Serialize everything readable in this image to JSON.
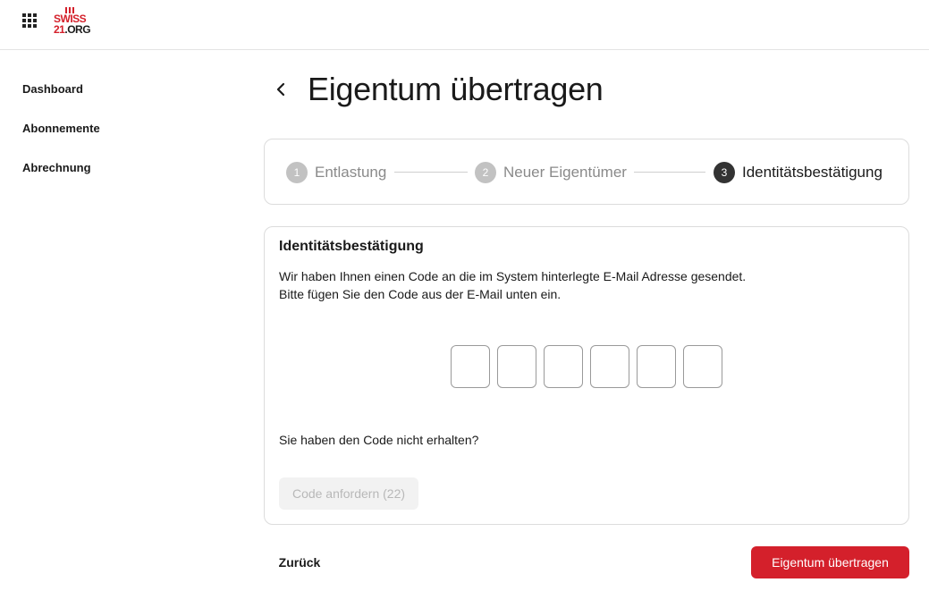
{
  "header": {
    "logo_top": "SWISS",
    "logo_bottom_a": "21",
    "logo_bottom_b": ".ORG"
  },
  "sidebar": {
    "items": [
      {
        "label": "Dashboard"
      },
      {
        "label": "Abonnemente"
      },
      {
        "label": "Abrechnung"
      }
    ]
  },
  "page": {
    "title": "Eigentum übertragen"
  },
  "stepper": {
    "steps": [
      {
        "number": "1",
        "label": "Entlastung",
        "state": "inactive"
      },
      {
        "number": "2",
        "label": "Neuer Eigentümer",
        "state": "inactive"
      },
      {
        "number": "3",
        "label": "Identitätsbestätigung",
        "state": "active"
      }
    ]
  },
  "verification": {
    "title": "Identitätsbestätigung",
    "description_line1": "Wir haben Ihnen einen Code an die im System hinterlegte E-Mail Adresse gesendet.",
    "description_line2": "Bitte fügen Sie den Code aus der E-Mail unten ein.",
    "code_digits": [
      "",
      "",
      "",
      "",
      "",
      ""
    ],
    "not_received": "Sie haben den Code nicht erhalten?",
    "resend_label": "Code anfordern (22)"
  },
  "actions": {
    "back_label": "Zurück",
    "submit_label": "Eigentum übertragen"
  },
  "colors": {
    "accent": "#d4202b",
    "step_active": "#333333",
    "step_inactive": "#c2c2c2"
  }
}
